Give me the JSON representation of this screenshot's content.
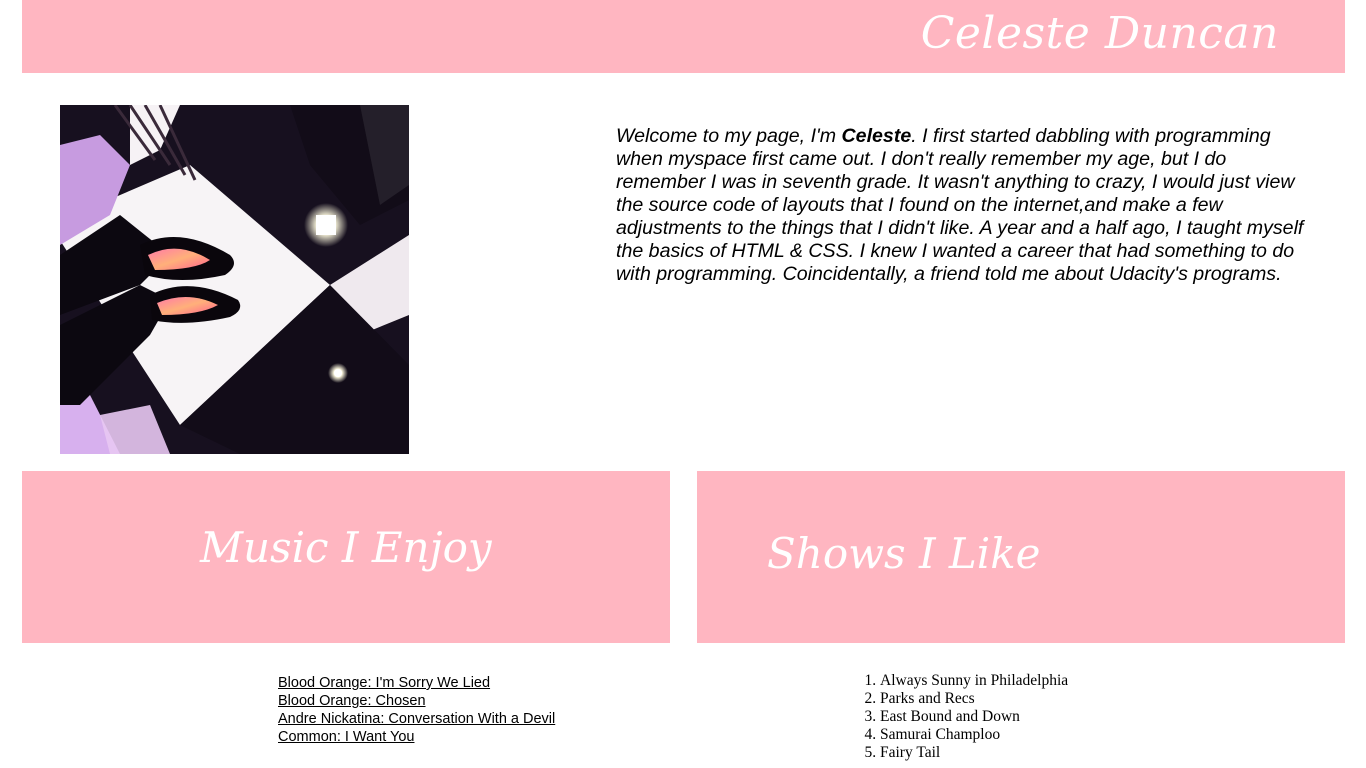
{
  "header": {
    "title": "Celeste Duncan"
  },
  "photo": {
    "alt": "Feet in black slip-on shoes standing on a black and white checkered floor"
  },
  "intro": {
    "text_before": "Welcome to my page, I'm ",
    "name": "Celeste",
    "text_after": ". I first started dabbling with programming when myspace first came out. I don't really remember my age, but I do remember I was in seventh grade. It wasn't anything to crazy, I would just view the source code of layouts that I found on the internet,and make a few adjustments to the things that I didn't like. A year and a half ago, I taught myself the basics of HTML & CSS. I knew I wanted a career that had something to do with programming. Coincidentally, a friend told me about Udacity's programs."
  },
  "music": {
    "heading": "Music I Enjoy",
    "items": [
      "Blood Orange: I'm Sorry We Lied ",
      "Blood Orange: Chosen ",
      "Andre Nickatina: Conversation With a Devil ",
      "Common: I Want You"
    ]
  },
  "shows": {
    "heading": "Shows I Like",
    "items": [
      "Always Sunny in Philadelphia",
      "Parks and Recs",
      "East Bound and Down",
      "Samurai Champloo",
      "Fairy Tail"
    ]
  },
  "colors": {
    "accent_pink": "#ffb6c1",
    "heading_text": "#ffffff"
  }
}
